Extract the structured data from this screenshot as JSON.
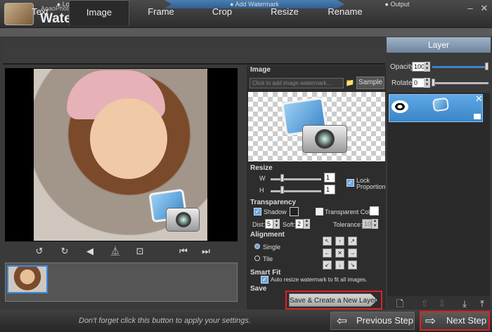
{
  "app": {
    "brand_small": "AoaoPhoto",
    "brand_big": "Watermark"
  },
  "window": {
    "minimize": "–",
    "close": "✕"
  },
  "steps": [
    {
      "label": "Load Photos"
    },
    {
      "label": "Add Watermark"
    },
    {
      "label": "Output"
    }
  ],
  "tabs": [
    "Text",
    "Image",
    "Frame",
    "Crop",
    "Resize",
    "Rename"
  ],
  "active_tab": "Image",
  "image_section": {
    "title": "Image",
    "placeholder": "Click to add image watermark...",
    "sample_label": "Sample"
  },
  "resize": {
    "title": "Resize",
    "w_label": "W",
    "h_label": "H",
    "w_value": "1",
    "h_value": "1",
    "lock_label": "Lock Proportion",
    "lock_checked": true
  },
  "transparency": {
    "title": "Transparency",
    "shadow_label": "Shadow",
    "shadow_checked": true,
    "transparent_color_label": "Transparent Color",
    "transparent_color_checked": false,
    "dist_label": "Dist:",
    "dist_value": "5",
    "soft_label": "Soft:",
    "soft_value": "2",
    "tolerance_label": "Tolerance:",
    "tolerance_value": "10"
  },
  "alignment": {
    "title": "Alignment",
    "single_label": "Single",
    "tile_label": "Tile",
    "selected": "Single"
  },
  "smart_fit": {
    "title": "Smart Fit",
    "label": "Auto resize watermark to fit all images.",
    "checked": true
  },
  "save": {
    "title": "Save",
    "button_label": "Save & Create a New Layer"
  },
  "layer_panel": {
    "title": "Layer",
    "opacity_label": "Opacity",
    "opacity_value": "100",
    "rotate_label": "Rotate",
    "rotate_value": "0"
  },
  "bottom": {
    "hint": "Don't forget click this button to apply your settings.",
    "prev_label": "Previous Step",
    "next_label": "Next Step"
  },
  "colors": {
    "accent": "#3b86c8",
    "highlight_red": "#e02020"
  }
}
